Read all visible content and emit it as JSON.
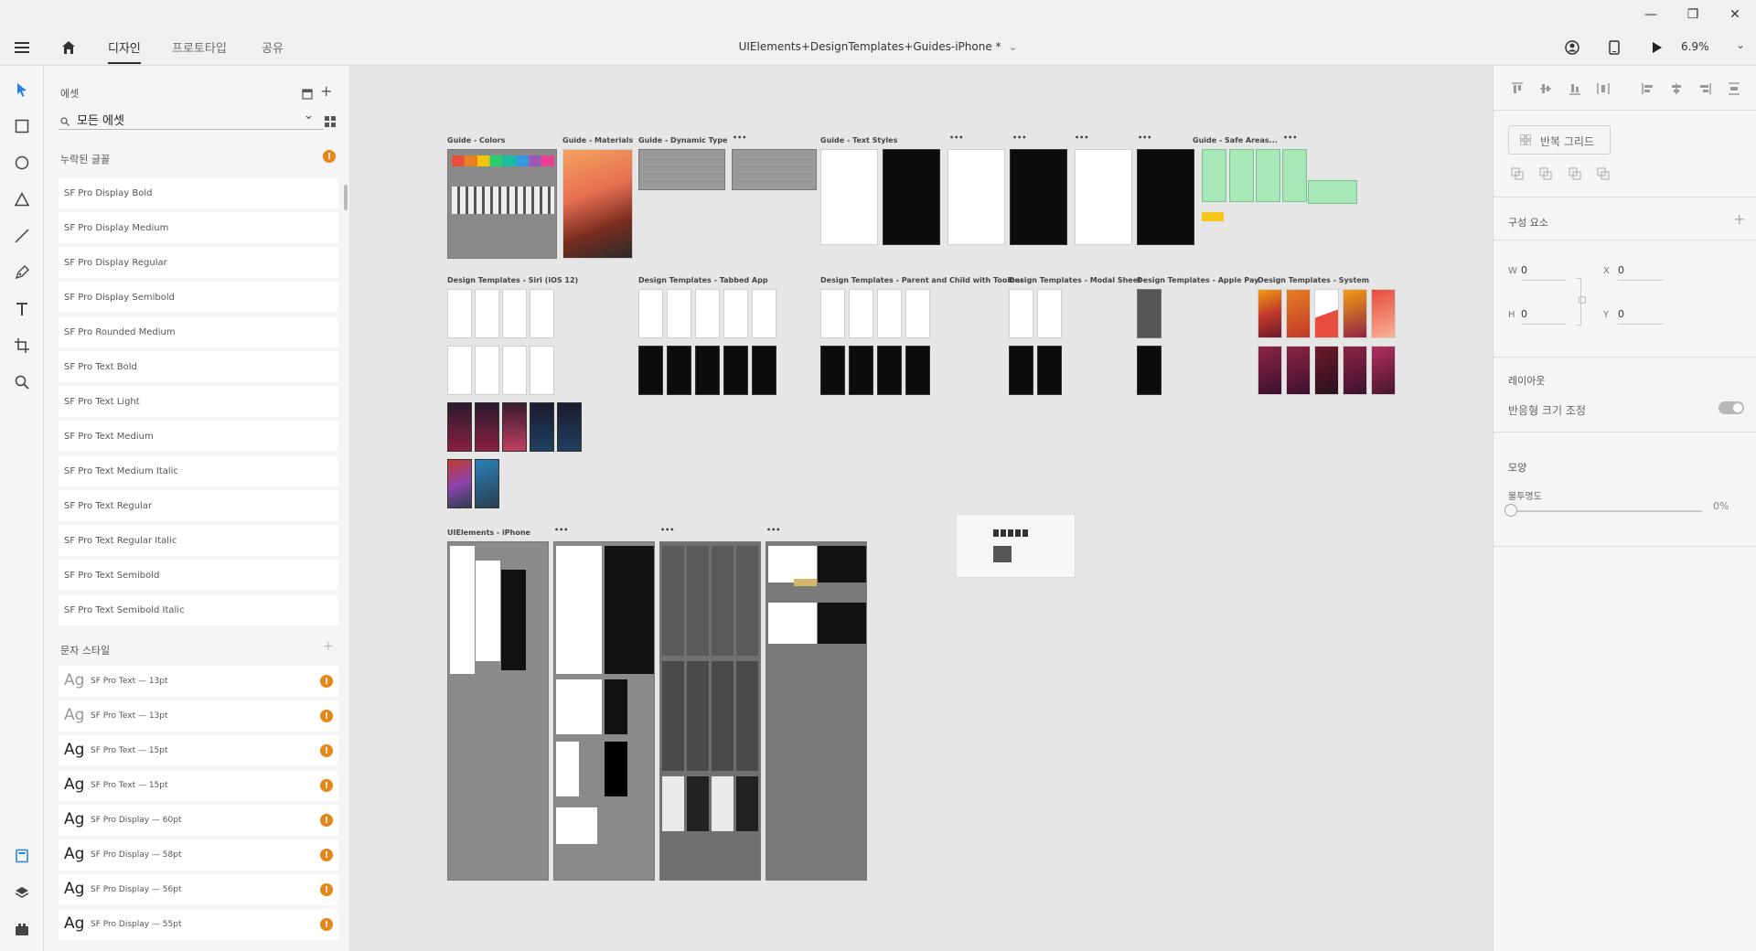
{
  "app": {
    "tabs": [
      "디자인",
      "프로토타입",
      "공유"
    ],
    "active_tab": "디자인",
    "document_title": "UIElements+DesignTemplates+Guides-iPhone *",
    "zoom": "6.9%"
  },
  "assets": {
    "header": "에셋",
    "filter_value": "모든 에셋",
    "missing_fonts_label": "누락된 글꼴",
    "fonts": [
      "SF Pro Display Bold",
      "SF Pro Display Medium",
      "SF Pro Display Regular",
      "SF Pro Display Semibold",
      "SF Pro Rounded Medium",
      "SF Pro Text Bold",
      "SF Pro Text Light",
      "SF Pro Text Medium",
      "SF Pro Text Medium Italic",
      "SF Pro Text Regular",
      "SF Pro Text Regular Italic",
      "SF Pro Text Semibold",
      "SF Pro Text Semibold Italic"
    ],
    "char_styles_label": "문자 스타일",
    "char_styles": [
      {
        "ag": "Ag",
        "label": "SF Pro Text — 13pt"
      },
      {
        "ag": "Ag",
        "label": "SF Pro Text — 13pt"
      },
      {
        "ag": "Ag",
        "label": "SF Pro Text — 15pt"
      },
      {
        "ag": "Ag",
        "label": "SF Pro Text — 15pt"
      },
      {
        "ag": "Ag",
        "label": "SF Pro Display — 60pt"
      },
      {
        "ag": "Ag",
        "label": "SF Pro Display — 58pt"
      },
      {
        "ag": "Ag",
        "label": "SF Pro Display — 56pt"
      },
      {
        "ag": "Ag",
        "label": "SF Pro Display — 55pt"
      }
    ],
    "warn_glyph": "!"
  },
  "canvas": {
    "labels": {
      "colors": "Guide - Colors",
      "materials": "Guide - Materials",
      "dynamic_type": "Guide - Dynamic Type",
      "text_styles": "Guide - Text Styles",
      "safe_areas": "Guide - Safe Areas...",
      "siri": "Design Templates - Siri (iOS 12)",
      "tabbed": "Design Templates - Tabbed App",
      "parent_child": "Design Templates - Parent and Child with Toolbar",
      "modal": "Design Templates - Modal Sheet",
      "apple_pay": "Design Templates - Apple Pay",
      "system": "Design Templates - System",
      "ui_elements": "UIElements - iPhone"
    },
    "more": "•••"
  },
  "properties": {
    "repeat_grid": "반복 그리드",
    "components": "구성 요소",
    "w_label": "W",
    "w": "0",
    "h_label": "H",
    "h": "0",
    "x_label": "X",
    "x": "0",
    "y_label": "Y",
    "y": "0",
    "layout": "레이아웃",
    "responsive_resize": "반응형 크기 조정",
    "responsive_on": true,
    "appearance": "모양",
    "opacity_label": "불투명도",
    "opacity": "0%"
  },
  "colors": {
    "accent": "#2680eb",
    "warning": "#e68619",
    "safe_area_green": "#a5e7b6"
  }
}
